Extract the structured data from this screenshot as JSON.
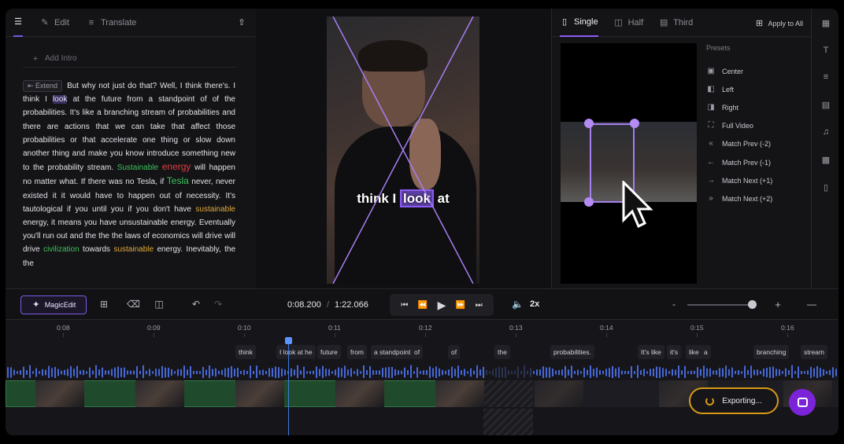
{
  "editor": {
    "tabs": [
      {
        "label": "",
        "icon": "document-icon"
      },
      {
        "label": "Edit",
        "icon": "pencil-icon"
      },
      {
        "label": "Translate",
        "icon": "translate-icon"
      }
    ],
    "add_intro": "Add Intro",
    "extend": "Extend",
    "transcript": {
      "t1": "But why not just do that? Well, I think there's. I think I",
      "hl": "look",
      "t2": "at the future from a standpoint of of the probabilities. It's like a branching stream of probabilities and there are actions that we can take that affect those probabilities or that accelerate one thing or slow down another thing and make you know introduce something new to the probability stream.",
      "w_sustainable": "Sustainable",
      "w_energy": "energy",
      "t3": "will happen no matter what. If there was no Tesla, if",
      "w_tesla": "Tesla",
      "t4": "never, never existed it it would have to happen out of necessity. It's tautological if you until you if you don't have",
      "w_sustainable2": "sustainable",
      "t5": "energy, it means you have unsustainable energy. Eventually you'll run out and the the the laws of economics will drive will drive",
      "w_civilization": "civilization",
      "t6": "towards",
      "w_sustainable3": "sustainable",
      "t7": "energy. Inevitably, the the"
    }
  },
  "video": {
    "caption_before": "think I ",
    "caption_highlight": "look",
    "caption_after": " at"
  },
  "layout_panel": {
    "tabs": [
      {
        "label": "Single",
        "icon": "phone-icon"
      },
      {
        "label": "Half",
        "icon": "half-icon"
      },
      {
        "label": "Third",
        "icon": "third-icon"
      }
    ],
    "apply_all": "Apply to All",
    "presets_title": "Presets",
    "presets": [
      {
        "label": "Center",
        "icon": "center-icon"
      },
      {
        "label": "Left",
        "icon": "align-left-icon"
      },
      {
        "label": "Right",
        "icon": "align-right-icon"
      },
      {
        "label": "Full Video",
        "icon": "expand-icon"
      },
      {
        "label": "Match Prev (-2)",
        "icon": "double-arrow-left-icon"
      },
      {
        "label": "Match Prev (-1)",
        "icon": "arrow-left-icon"
      },
      {
        "label": "Match Next (+1)",
        "icon": "arrow-right-icon"
      },
      {
        "label": "Match Next (+2)",
        "icon": "double-arrow-right-icon"
      }
    ]
  },
  "controls": {
    "magic_edit": "MagicEdit",
    "current_time": "0:08.200",
    "separator": "/",
    "total_time": "1:22.066",
    "speed": "2x",
    "zoom_minus": "-",
    "zoom_plus": "+",
    "zoom_level": 0.95
  },
  "timeline": {
    "ticks": [
      "0:08",
      "0:09",
      "0:10",
      "0:11",
      "0:12",
      "0:13",
      "0:14",
      "0:15",
      "0:16"
    ],
    "words": [
      "think",
      "I look at he",
      "future",
      "from",
      "a standpoint",
      "of",
      "of",
      "the",
      "probabilities.",
      "It's like",
      "it's",
      "like",
      "a",
      "branching",
      "stream"
    ]
  },
  "export": {
    "label": "Exporting..."
  },
  "colors": {
    "accent": "#8b5cf6",
    "export_ring": "#d89a16",
    "playhead": "#3d7be0",
    "chat": "#7a23d8"
  }
}
